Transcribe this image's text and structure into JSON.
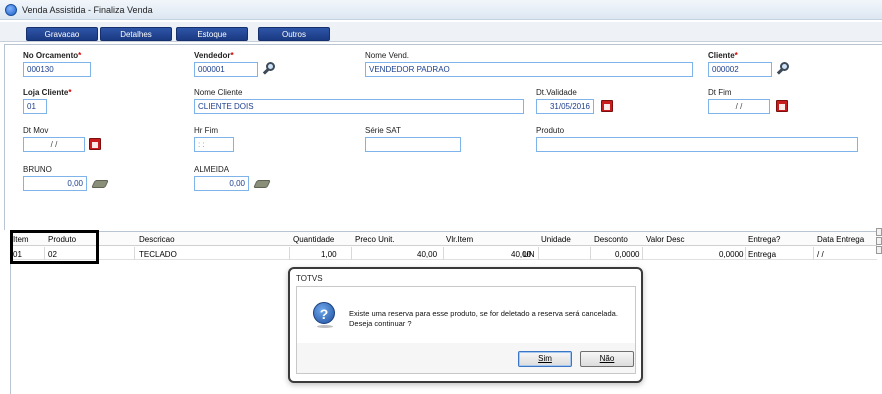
{
  "window": {
    "title": "Venda Assistida - Finaliza Venda"
  },
  "toolbar": {
    "buttons": [
      "Gravacao",
      "Detalhes",
      "Estoque",
      "Outros"
    ]
  },
  "form": {
    "orcamento": {
      "label": "No Orcamento",
      "value": "000130"
    },
    "vendedor": {
      "label": "Vendedor",
      "value": "000001"
    },
    "nome_vend": {
      "label": "Nome Vend.",
      "value": "VENDEDOR PADRAO"
    },
    "cliente": {
      "label": "Cliente",
      "value": "000002"
    },
    "loja_cliente": {
      "label": "Loja Cliente",
      "value": "01"
    },
    "nome_cliente": {
      "label": "Nome Cliente",
      "value": "CLIENTE DOIS"
    },
    "dt_validade": {
      "label": "Dt.Validade",
      "value": "31/05/2016"
    },
    "dt_fim": {
      "label": "Dt Fim",
      "value": "/ /"
    },
    "dt_mov": {
      "label": "Dt Mov",
      "value": "/ /"
    },
    "hr_fim": {
      "label": "Hr Fim",
      "value": ": :"
    },
    "serie_sat": {
      "label": "Série SAT",
      "value": ""
    },
    "produto": {
      "label": "Produto",
      "value": ""
    },
    "bruno": {
      "label": "BRUNO",
      "value": "0,00"
    },
    "almeida": {
      "label": "ALMEIDA",
      "value": "0,00"
    },
    "required_mark": "*"
  },
  "grid": {
    "headers": [
      "Item",
      "Produto",
      "Descricao",
      "Quantidade",
      "Preco Unit.",
      "Vlr.Item",
      "Unidade",
      "Desconto",
      "Valor Desc",
      "Entrega?",
      "Data Entrega"
    ],
    "rows": [
      [
        "01",
        "02",
        "TECLADO",
        "1,00",
        "40,00",
        "40,00",
        "UN",
        "0,0000",
        "0,0000",
        "Entrega",
        "/ /"
      ]
    ]
  },
  "dialog": {
    "title": "TOTVS",
    "message_line1": "Existe uma reserva para esse produto, se for deletado a reserva será cancelada.",
    "message_line2": "Deseja continuar ?",
    "yes_label": "Sim",
    "no_label": "Não"
  }
}
